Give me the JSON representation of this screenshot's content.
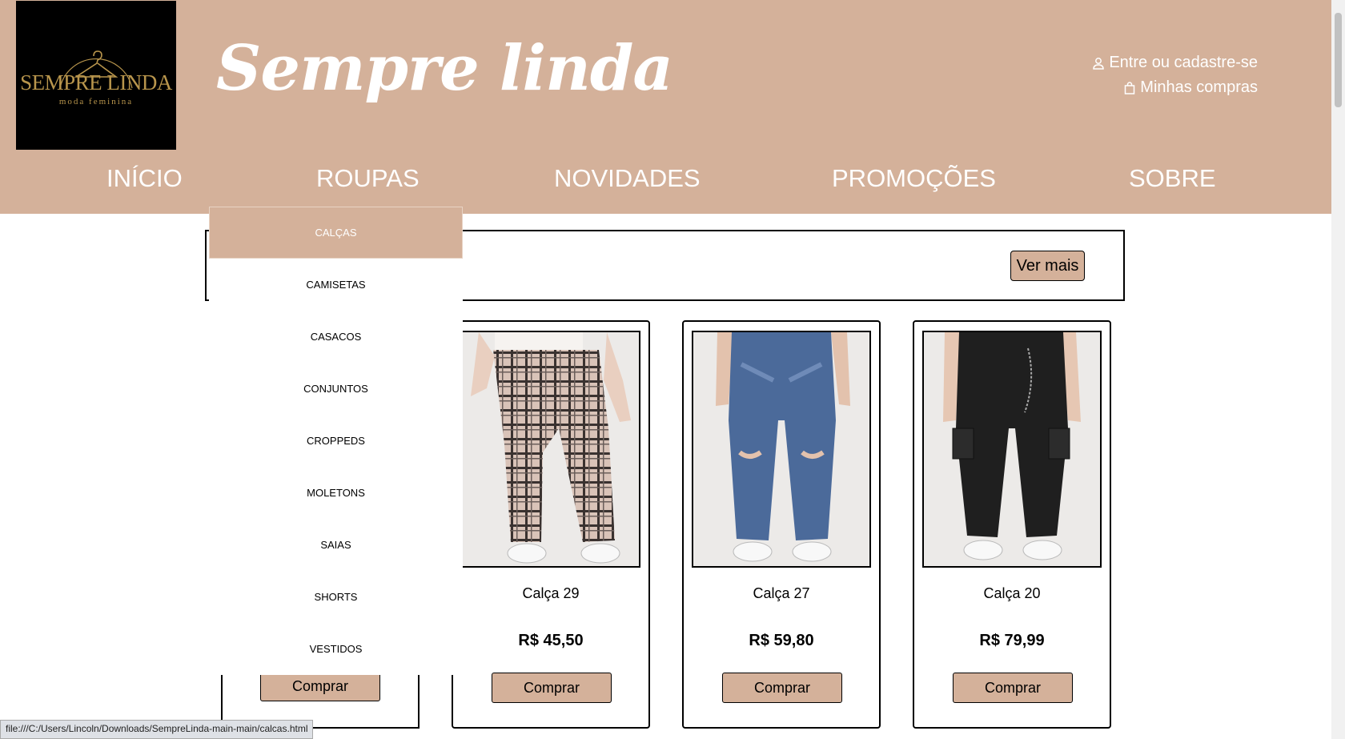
{
  "brand": {
    "logo_main": "SEMPRE LINDA",
    "logo_sub": "moda feminina",
    "title": "Sempre linda"
  },
  "account": {
    "login_icon": "user-icon",
    "login": "Entre ou cadastre-se",
    "cart_icon": "shopping-bag-icon",
    "purchases": "Minhas compras"
  },
  "nav": {
    "items": [
      "INÍCIO",
      "ROUPAS",
      "NOVIDADES",
      "PROMOÇÕES",
      "SOBRE"
    ]
  },
  "dropdown": {
    "items": [
      "CALÇAS",
      "CAMISETAS",
      "CASACOS",
      "CONJUNTOS",
      "CROPPEDS",
      "MOLETONS",
      "SAIAS",
      "SHORTS",
      "VESTIDOS"
    ],
    "active": "CALÇAS"
  },
  "filter": {
    "ver_mais": "Ver mais"
  },
  "products": [
    {
      "name": "Calça 29",
      "price": "R$ 45,50",
      "buy": "Comprar"
    },
    {
      "name": "Calça 27",
      "price": "R$ 59,80",
      "buy": "Comprar"
    },
    {
      "name": "Calça 20",
      "price": "R$ 79,99",
      "buy": "Comprar"
    }
  ],
  "partial_card": {
    "buy": "Comprar"
  },
  "status_bar": "file:///C:/Users/Lincoln/Downloads/SempreLinda-main-main/calcas.html",
  "colors": {
    "brand": "#d4b19a",
    "logo_gold": "#b8954c"
  }
}
